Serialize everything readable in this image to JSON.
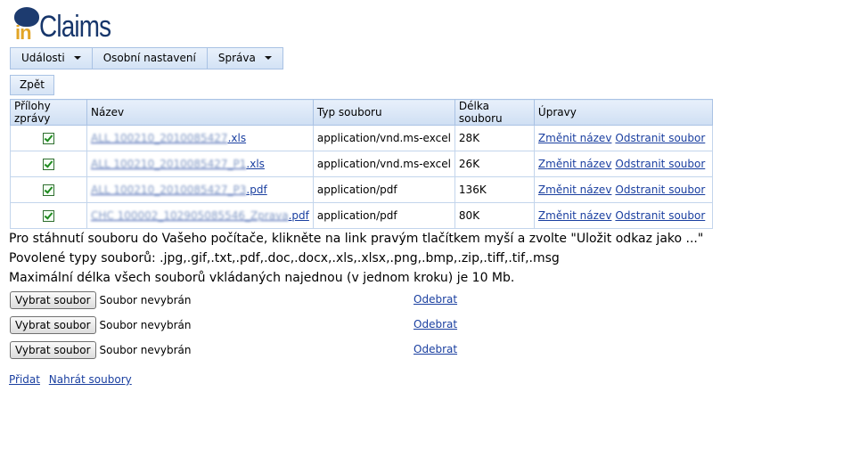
{
  "logo": {
    "prefix": "in",
    "name": "Claims"
  },
  "menu": {
    "items": [
      {
        "label": "Události",
        "has_dropdown": true
      },
      {
        "label": "Osobní nastavení",
        "has_dropdown": false
      },
      {
        "label": "Správa",
        "has_dropdown": true
      }
    ]
  },
  "back_label": "Zpět",
  "attachments": {
    "headers": [
      "Přílohy zprávy",
      "Název",
      "Typ souboru",
      "Délka souboru",
      "Úpravy"
    ],
    "rows": [
      {
        "checked": true,
        "name_blur": "ALL 100210_2010085427",
        "name_ext": ".xls",
        "type": "application/vnd.ms-excel",
        "size": "28K"
      },
      {
        "checked": true,
        "name_blur": "ALL 100210_2010085427_P1",
        "name_ext": ".xls",
        "type": "application/vnd.ms-excel",
        "size": "26K"
      },
      {
        "checked": true,
        "name_blur": "ALL 100210_2010085427_P3",
        "name_ext": ".pdf",
        "type": "application/pdf",
        "size": "136K"
      },
      {
        "checked": true,
        "name_blur": "CHC 100002_102905085546_Zprava",
        "name_ext": ".pdf",
        "type": "application/pdf",
        "size": "80K"
      }
    ],
    "rename_label": "Změnit název",
    "delete_label": "Odstranit soubor"
  },
  "info": {
    "line1": "Pro stáhnutí souboru do Vašeho počítače, klikněte na link pravým tlačítkem myší a zvolte \"Uložit odkaz jako ...\"",
    "line2": "Povolené typy souborů: .jpg,.gif,.txt,.pdf,.doc,.docx,.xls,.xlsx,.png,.bmp,.zip,.tiff,.tif,.msg",
    "line3": "Maximální délka všech souborů vkládaných najednou (v jednom kroku) je 10 Mb."
  },
  "upload": {
    "choose_label": "Vybrat soubor",
    "no_file_label": "Soubor nevybrán",
    "remove_label": "Odebrat"
  },
  "actions": {
    "add_label": "Přidat",
    "upload_label": "Nahrát soubory"
  }
}
